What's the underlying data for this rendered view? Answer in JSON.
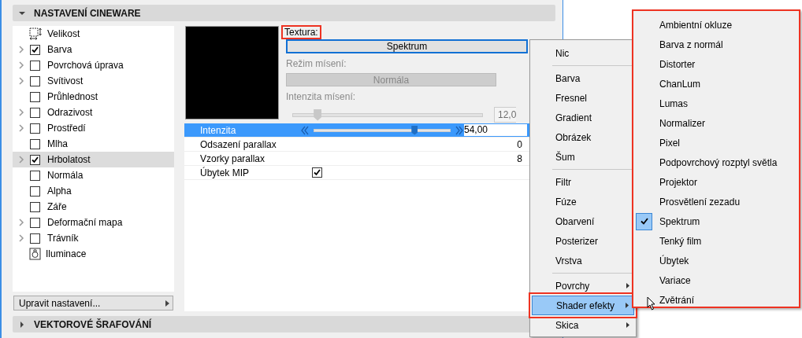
{
  "header": {
    "title": "NASTAVENÍ CINEWARE",
    "expanded": true
  },
  "channels": [
    {
      "kind": "size",
      "label": "Velikost",
      "expandable": false,
      "selected": false
    },
    {
      "kind": "check",
      "label": "Barva",
      "expandable": true,
      "checked": true,
      "selected": false
    },
    {
      "kind": "check",
      "label": "Povrchová úprava",
      "expandable": true,
      "checked": false,
      "selected": false
    },
    {
      "kind": "check",
      "label": "Svítivost",
      "expandable": true,
      "checked": false,
      "selected": false
    },
    {
      "kind": "check",
      "label": "Průhlednost",
      "expandable": false,
      "checked": false,
      "selected": false
    },
    {
      "kind": "check",
      "label": "Odrazivost",
      "expandable": true,
      "checked": false,
      "selected": false
    },
    {
      "kind": "check",
      "label": "Prostředí",
      "expandable": true,
      "checked": false,
      "selected": false
    },
    {
      "kind": "check",
      "label": "Mlha",
      "expandable": false,
      "checked": false,
      "selected": false
    },
    {
      "kind": "check",
      "label": "Hrbolatost",
      "expandable": true,
      "checked": true,
      "selected": true
    },
    {
      "kind": "check",
      "label": "Normála",
      "expandable": false,
      "checked": false,
      "selected": false
    },
    {
      "kind": "check",
      "label": "Alpha",
      "expandable": false,
      "checked": false,
      "selected": false
    },
    {
      "kind": "check",
      "label": "Záře",
      "expandable": false,
      "checked": false,
      "selected": false
    },
    {
      "kind": "check",
      "label": "Deformační mapa",
      "expandable": true,
      "checked": false,
      "selected": false
    },
    {
      "kind": "check",
      "label": "Trávník",
      "expandable": true,
      "checked": false,
      "selected": false
    },
    {
      "kind": "light",
      "label": "Iluminace",
      "expandable": false,
      "selected": false
    }
  ],
  "edit_button": "Upravit nastavení...",
  "texture": {
    "label": "Textura:",
    "value": "Spektrum"
  },
  "blend_mode": {
    "label": "Režim mísení:",
    "value": "Normála",
    "disabled": true
  },
  "blend_intensity": {
    "label": "Intenzita mísení:",
    "level": 0.13,
    "value": "12,0",
    "disabled": true
  },
  "properties": [
    {
      "kind": "slider",
      "name": "Intenzita",
      "selected": true,
      "level": 0.74,
      "value": "54,00"
    },
    {
      "kind": "number",
      "name": "Odsazení parallax",
      "selected": false,
      "value": "0"
    },
    {
      "kind": "number",
      "name": "Vzorky parallax",
      "selected": false,
      "value": "8"
    },
    {
      "kind": "checkbox",
      "name": "Úbytek MIP",
      "selected": false,
      "checked": true
    }
  ],
  "footer_section": {
    "title": "VEKTOROVÉ ŠRAFOVÁNÍ",
    "expanded": false
  },
  "menu": [
    [
      {
        "label": "Nic",
        "submenu": false,
        "selected": false
      }
    ],
    [
      {
        "label": "Barva",
        "submenu": false,
        "selected": false
      },
      {
        "label": "Fresnel",
        "submenu": false,
        "selected": false
      },
      {
        "label": "Gradient",
        "submenu": false,
        "selected": false
      },
      {
        "label": "Obrázek",
        "submenu": false,
        "selected": false
      },
      {
        "label": "Šum",
        "submenu": false,
        "selected": false
      }
    ],
    [
      {
        "label": "Filtr",
        "submenu": false,
        "selected": false
      },
      {
        "label": "Fúze",
        "submenu": false,
        "selected": false
      },
      {
        "label": "Obarvení",
        "submenu": false,
        "selected": false
      },
      {
        "label": "Posterizer",
        "submenu": false,
        "selected": false
      },
      {
        "label": "Vrstva",
        "submenu": false,
        "selected": false
      }
    ],
    [
      {
        "label": "Povrchy",
        "submenu": true,
        "selected": false
      },
      {
        "label": "Shader efekty",
        "submenu": true,
        "selected": true
      },
      {
        "label": "Skica",
        "submenu": true,
        "selected": false
      }
    ]
  ],
  "submenu": [
    {
      "label": "Ambientní okluze",
      "checked": false
    },
    {
      "label": "Barva z normál",
      "checked": false
    },
    {
      "label": "Distorter",
      "checked": false
    },
    {
      "label": "ChanLum",
      "checked": false
    },
    {
      "label": "Lumas",
      "checked": false
    },
    {
      "label": "Normalizer",
      "checked": false
    },
    {
      "label": "Pixel",
      "checked": false
    },
    {
      "label": "Podpovrchový rozptyl světla",
      "checked": false
    },
    {
      "label": "Projektor",
      "checked": false
    },
    {
      "label": "Prosvětlení zezadu",
      "checked": false
    },
    {
      "label": "Spektrum",
      "checked": true
    },
    {
      "label": "Tenký film",
      "checked": false
    },
    {
      "label": "Úbytek",
      "checked": false
    },
    {
      "label": "Variace",
      "checked": false
    },
    {
      "label": "Zvětrání",
      "checked": false
    }
  ]
}
